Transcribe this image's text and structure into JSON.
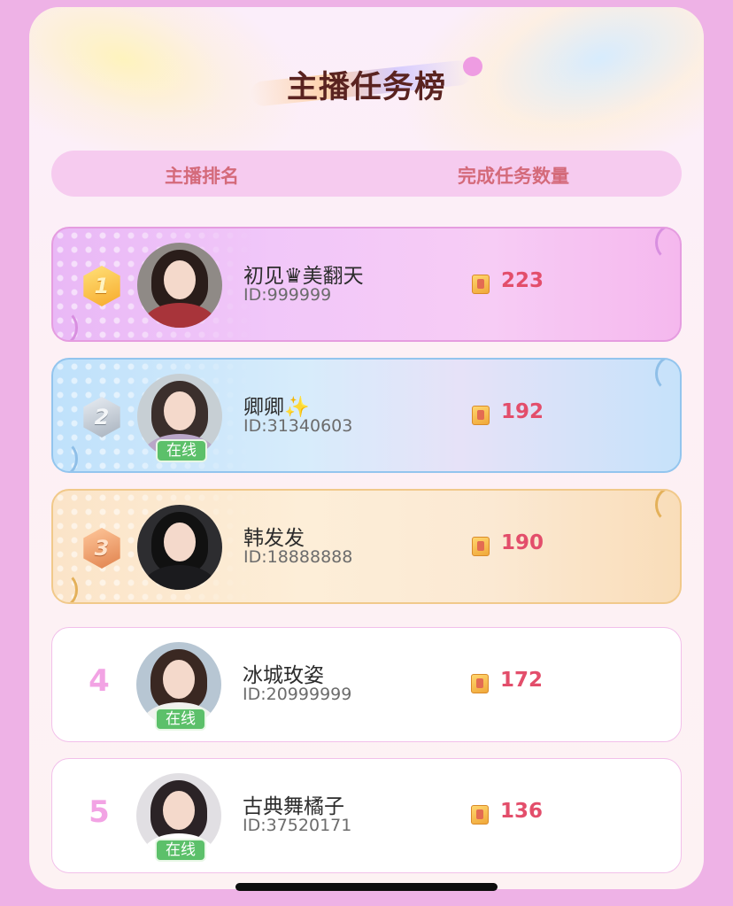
{
  "title": "主播任务榜",
  "header": {
    "rank_label": "主播排名",
    "count_label": "完成任务数量"
  },
  "rows": [
    {
      "rank": "1",
      "medal": "gold",
      "name": "初见♛美翻天",
      "id": "ID:999999",
      "count": "223",
      "online": false
    },
    {
      "rank": "2",
      "medal": "silver",
      "name": "卿卿✨",
      "id": "ID:31340603",
      "count": "192",
      "online": true,
      "online_label": "在线"
    },
    {
      "rank": "3",
      "medal": "bronze",
      "name": "韩发发",
      "id": "ID:18888888",
      "count": "190",
      "online": false
    },
    {
      "rank": "4",
      "name": "冰城玫姿",
      "id": "ID:20999999",
      "count": "172",
      "online": true,
      "online_label": "在线"
    },
    {
      "rank": "5",
      "name": "古典舞橘子",
      "id": "ID:37520171",
      "count": "136",
      "online": true,
      "online_label": "在线"
    }
  ],
  "colors": {
    "background": "#eeb2e6",
    "title": "#5a2320",
    "header_text": "#d46a7a",
    "count_text": "#e34e6b",
    "online_badge": "#5cc06a"
  }
}
